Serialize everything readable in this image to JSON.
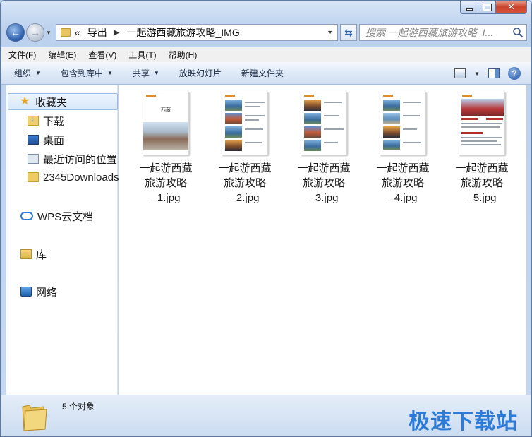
{
  "window": {
    "colors": {
      "accent": "#2d7bd8",
      "selection": "#d8e7fa"
    }
  },
  "nav": {
    "back_icon": "back-arrow-icon",
    "forward_icon": "forward-arrow-icon",
    "address": {
      "prefix": "«",
      "segments": [
        "导出",
        "一起游西藏旅游攻略_IMG"
      ]
    },
    "search_placeholder": "搜索 一起游西藏旅游攻略_I..."
  },
  "menu": [
    "文件(F)",
    "编辑(E)",
    "查看(V)",
    "工具(T)",
    "帮助(H)"
  ],
  "commands": {
    "organize": "组织",
    "include_library": "包含到库中",
    "share": "共享",
    "slideshow": "放映幻灯片",
    "new_folder": "新建文件夹"
  },
  "sidebar": {
    "favorites": "收藏夹",
    "items": [
      "下载",
      "桌面",
      "最近访问的位置",
      "2345Downloads"
    ],
    "wps": "WPS云文档",
    "library": "库",
    "network": "网络"
  },
  "files": [
    {
      "name": "一起游西藏旅游攻略_1.jpg",
      "line1": "一起游西藏",
      "line2": "旅游攻略",
      "line3": "_1.jpg",
      "cover_text": "西藏"
    },
    {
      "name": "一起游西藏旅游攻略_2.jpg",
      "line1": "一起游西藏",
      "line2": "旅游攻略",
      "line3": "_2.jpg"
    },
    {
      "name": "一起游西藏旅游攻略_3.jpg",
      "line1": "一起游西藏",
      "line2": "旅游攻略",
      "line3": "_3.jpg"
    },
    {
      "name": "一起游西藏旅游攻略_4.jpg",
      "line1": "一起游西藏",
      "line2": "旅游攻略",
      "line3": "_4.jpg"
    },
    {
      "name": "一起游西藏旅游攻略_5.jpg",
      "line1": "一起游西藏",
      "line2": "旅游攻略",
      "line3": "_5.jpg"
    }
  ],
  "status": {
    "count": "5 个对象"
  },
  "watermark": "极速下载站"
}
